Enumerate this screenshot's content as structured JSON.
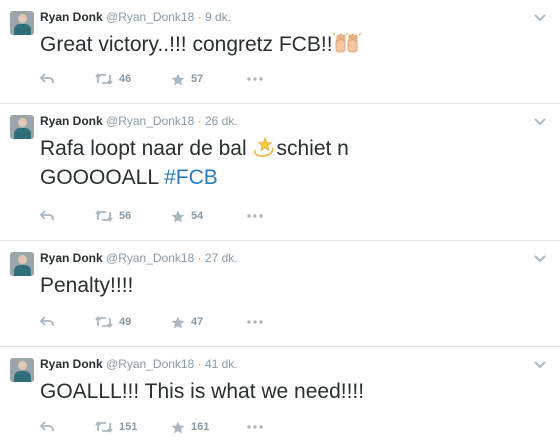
{
  "tweets": [
    {
      "author_name": "Ryan Donk",
      "handle": "@Ryan_Donk18",
      "separator": "·",
      "time": "9 dk.",
      "text_parts": [
        "Great victory..!!! congretz FCB!!",
        "",
        ""
      ],
      "emoji": "raised-hands-emoji",
      "retweets": "46",
      "favorites": "57"
    },
    {
      "author_name": "Ryan Donk",
      "handle": "@Ryan_Donk18",
      "separator": "·",
      "time": "26 dk.",
      "text_parts": [
        "Rafa loopt naar de bal ",
        "schiet n",
        "GOOOOALL "
      ],
      "hashtag": "#FCB",
      "emoji": "dizzy-star-emoji",
      "retweets": "56",
      "favorites": "54"
    },
    {
      "author_name": "Ryan Donk",
      "handle": "@Ryan_Donk18",
      "separator": "·",
      "time": "27 dk.",
      "text_parts": [
        "Penalty!!!!"
      ],
      "retweets": "49",
      "favorites": "47"
    },
    {
      "author_name": "Ryan Donk",
      "handle": "@Ryan_Donk18",
      "separator": "·",
      "time": "41 dk.",
      "text_parts": [
        "GOALLL!!! This is  what we need!!!!"
      ],
      "retweets": "151",
      "favorites": "161"
    }
  ],
  "icons": {
    "reply": "reply-icon",
    "retweet": "retweet-icon",
    "favorite": "star-icon",
    "more": "more-dots-icon",
    "menu": "chevron-down-icon"
  },
  "colors": {
    "text": "#292f33",
    "muted": "#8899a6",
    "hashtag": "#2b7bb9",
    "divider": "#e1e8ed"
  }
}
